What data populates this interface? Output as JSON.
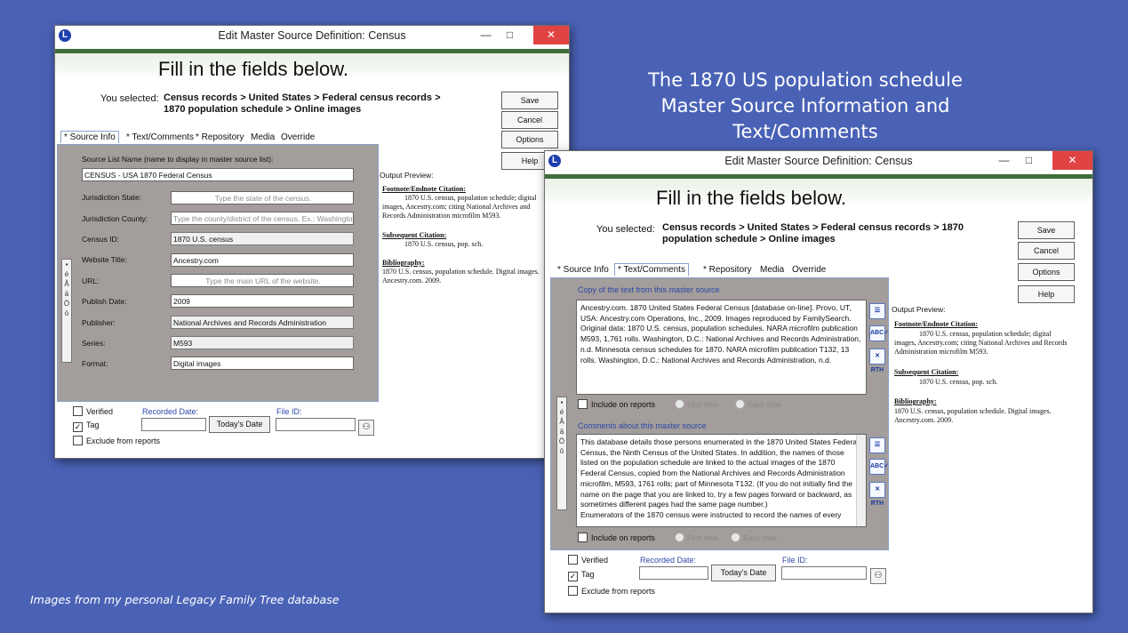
{
  "caption": {
    "line1": "The 1870 US population schedule",
    "line2": "Master Source Information and Text/Comments"
  },
  "footnote": "Images from my personal Legacy Family Tree database",
  "window_common": {
    "title": "Edit Master Source Definition: Census",
    "app_icon": "L",
    "banner_title": "Fill in the fields below.",
    "selected_label": "You selected:",
    "selected_value": "Census records > United States > Federal census records > 1870 population schedule > Online images",
    "buttons": {
      "save": "Save",
      "cancel": "Cancel",
      "options": "Options",
      "help": "Help"
    },
    "controls": {
      "minimize": "—",
      "maximize": "□",
      "close": "✕"
    }
  },
  "window1": {
    "tabs": [
      "* Source Info",
      "* Text/Comments",
      "* Repository",
      "Media",
      "Override"
    ],
    "active_tab": "* Source Info",
    "source_list_label": "Source List Name (name to display in master source list):",
    "source_list_value": "CENSUS  -  USA 1870 Federal Census",
    "fields": [
      {
        "label": "Jurisdiction State:",
        "value": "",
        "placeholder": "Type the state of the census."
      },
      {
        "label": "Jurisdiction County:",
        "value": "",
        "placeholder": "Type the county/district of the census. Ex.: Washington"
      },
      {
        "label": "Census ID:",
        "value": "1870 U.S. census",
        "placeholder": ""
      },
      {
        "label": "Website Title:",
        "value": "Ancestry.com",
        "placeholder": ""
      },
      {
        "label": "URL:",
        "value": "",
        "placeholder": "Type the main URL of the website."
      },
      {
        "label": "Publish Date:",
        "value": "2009",
        "placeholder": ""
      },
      {
        "label": "Publisher:",
        "value": "National Archives and Records Administration",
        "placeholder": ""
      },
      {
        "label": "Series:",
        "value": "M593",
        "placeholder": ""
      },
      {
        "label": "Format:",
        "value": "Digital images",
        "placeholder": ""
      }
    ],
    "side_chars": [
      "▪",
      "é",
      "Å",
      "ä",
      "Ö",
      "ö"
    ],
    "verified": {
      "label": "Verified",
      "checked": false
    },
    "tag": {
      "label": "Tag",
      "checked": true
    },
    "exclude": {
      "label": "Exclude from reports",
      "checked": false
    },
    "recorded_date_label": "Recorded Date:",
    "todays_date_button": "Today's Date",
    "file_id_label": "File ID:",
    "output_preview": {
      "title": "Output Preview:",
      "footnote_heading": "Footnote/Endnote Citation:",
      "footnote_text": "1870 U.S. census, population schedule; digital images, Ancestry.com; citing National Archives and Records Administration microfilm M593.",
      "subsequent_heading": "Subsequent Citation:",
      "subsequent_text": "1870 U.S. census, pop. sch.",
      "bibliography_heading": "Bibliography:",
      "bibliography_text": "1870 U.S. census, population schedule. Digital images. Ancestry.com. 2009."
    }
  },
  "window2": {
    "tabs": [
      "* Source Info",
      "* Text/Comments",
      "* Repository",
      "Media",
      "Override"
    ],
    "active_tab": "* Text/Comments",
    "text_label": "Copy of the text from this master source",
    "text_value": "Ancestry.com. 1870 United States Federal Census [database on-line]. Provo, UT, USA: Ancestry.com Operations, Inc., 2009. Images reproduced by FamilySearch. Original data:  1870 U.S. census, population schedules. NARA microfilm publication M593, 1,761 rolls. Washington, D.C.: National Archives and Records Administration, n.d.  Minnesota census schedules for 1870. NARA microfilm publication T132, 13 rolls. Washington, D.C.: National Archives and Records Administration, n.d.",
    "include_reports": "Include on reports",
    "first_time": "First time",
    "each_time": "Each time",
    "comments_label": "Comments about this master source",
    "comments_value": "This database details those persons enumerated in the 1870 United States Federal Census, the Ninth Census of the United States. In addition, the names of those listed on the population schedule are linked to the actual images of the 1870 Federal Census, copied from the National Archives and Records Administration microfilm, M593, 1761 rolls; part of Minnesota T132. (If you do not initially find the name on the page that you are linked to, try a few pages forward or backward, as sometimes different pages had the same page number.)\nEnumerators of the 1870 census were instructed to record the names of every",
    "icons": [
      "☰",
      "ABC✓",
      "✕ RTH"
    ],
    "side_chars": [
      "▪",
      "é",
      "Å",
      "ä",
      "Ö",
      "ö"
    ],
    "verified": {
      "label": "Verified",
      "checked": false
    },
    "tag": {
      "label": "Tag",
      "checked": true
    },
    "exclude": {
      "label": "Exclude from reports",
      "checked": false
    },
    "recorded_date_label": "Recorded Date:",
    "todays_date_button": "Today's Date",
    "file_id_label": "File ID:",
    "output_preview": {
      "title": "Output Preview:",
      "footnote_heading": "Footnote/Endnote Citation:",
      "footnote_text": "1870 U.S. census, population schedule; digital images, Ancestry.com; citing National Archives and Records Administration microfilm M593.",
      "subsequent_heading": "Subsequent Citation:",
      "subsequent_text": "1870 U.S. census, pop. sch.",
      "bibliography_heading": "Bibliography:",
      "bibliography_text": "1870 U.S. census, population schedule. Digital images. Ancestry.com. 2009."
    }
  }
}
